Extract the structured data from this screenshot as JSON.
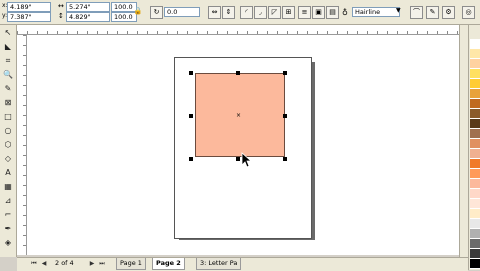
{
  "propbar": {
    "x_value": "4.189\"",
    "y_value": "7.387\"",
    "width_value": "5.274\"",
    "height_value": "4.829\"",
    "scale_x": "100.0",
    "scale_y": "100.0",
    "rotation_value": "0.0",
    "outline_width": "Hairline"
  },
  "page_nav": {
    "counter": "2 of 4",
    "tabs": [
      "Page 1",
      "Page 2",
      "3: Letter Pa"
    ]
  },
  "shape": {
    "fill_color": "#fcb99c"
  },
  "palette": [
    "#ffffff",
    "#ffe7a8",
    "#ffd2a0",
    "#ffe060",
    "#ffcc33",
    "#e8a23a",
    "#c06a20",
    "#8a5a2a",
    "#5a3a1a",
    "#a07050",
    "#e09060",
    "#f0b090",
    "#f07a2a",
    "#ff9a5a",
    "#fcb99c",
    "#ffd8c8",
    "#ffe6d8",
    "#ffecc8",
    "#e8e8e8",
    "#b0b0b0",
    "#6a6a6a",
    "#3a3a3a",
    "#000000"
  ]
}
